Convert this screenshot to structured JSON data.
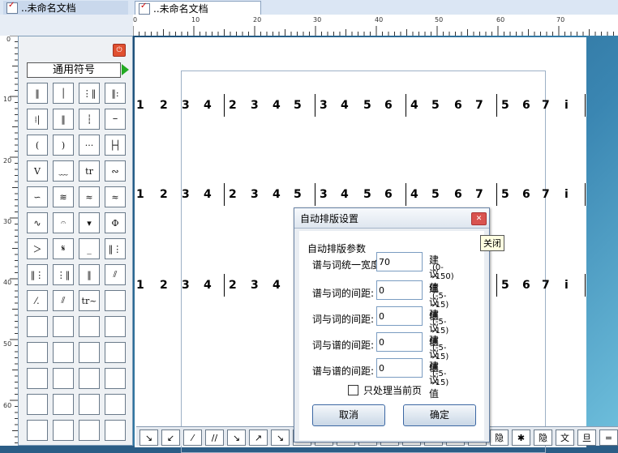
{
  "tabs": [
    "..未命名文档",
    "..未命名文档"
  ],
  "ruler": {
    "h_labels": [
      "0",
      "10",
      "20",
      "30",
      "40",
      "50",
      "60",
      "70"
    ],
    "v_labels": [
      "0",
      "10",
      "20",
      "30",
      "40",
      "50",
      "60"
    ]
  },
  "palette": {
    "title": "通用符号",
    "close_icon": "close-icon",
    "cells": [
      "‖",
      "│",
      "⋮‖",
      "‖:",
      "⁞|",
      "‖",
      "┆",
      "ⲻ",
      "(",
      ")",
      "···",
      "├┤",
      "V",
      "﹏",
      "tr",
      "∾",
      "∽",
      "≋",
      "≈",
      "≈",
      "∿",
      "𝄐",
      "▾",
      "Φ",
      "＞",
      "𝄋",
      "_",
      "‖⋮",
      "‖⋮",
      "⋮‖",
      "‖",
      "⫽",
      "⁄.",
      "⫽",
      "tr~",
      "",
      "",
      "",
      "",
      "",
      "",
      "",
      "",
      "",
      "",
      "",
      "",
      "",
      "",
      "",
      "",
      "",
      "",
      "",
      "",
      ""
    ]
  },
  "score": {
    "staffs": [
      {
        "notes": [
          "1",
          "2",
          "3",
          "4",
          "2",
          "3",
          "4",
          "5",
          "3",
          "4",
          "5",
          "6",
          "4",
          "5",
          "6",
          "7",
          "5",
          "6",
          "7",
          "i"
        ]
      },
      {
        "notes": [
          "1",
          "2",
          "3",
          "4",
          "2",
          "3",
          "4",
          "5",
          "3",
          "4",
          "5",
          "6",
          "4",
          "5",
          "6",
          "7",
          "5",
          "6",
          "7",
          "i"
        ]
      },
      {
        "notes": [
          "1",
          "2",
          "3",
          "4",
          "2",
          "3",
          "4",
          "5",
          "",
          "",
          "",
          "",
          "",
          "",
          "",
          "",
          "5",
          "6",
          "7",
          "i"
        ]
      }
    ]
  },
  "bottom_toolbar": [
    "↘",
    "↙",
    "⁄",
    "//",
    "↘",
    "↗",
    "↘",
    "·",
    "",
    "",
    "",
    "",
    "",
    "",
    "",
    "隐",
    "隐",
    "✱",
    "隐",
    "文",
    "旦",
    "="
  ],
  "dialog": {
    "title": "自动排版设置",
    "group_label": "自动排版参数",
    "fields": [
      {
        "label": "谱与词统一宽度:",
        "value": "70",
        "hint": "建议值",
        "range": "(0--150)"
      },
      {
        "label": "谱与词的间距:",
        "value": "0",
        "hint": "建议值",
        "range": "(-5--15)"
      },
      {
        "label": "词与词的间距:",
        "value": "0",
        "hint": "建议值",
        "range": "(-5--15)"
      },
      {
        "label": "词与谱的间距:",
        "value": "0",
        "hint": "建议值",
        "range": "(-5--15)"
      },
      {
        "label": "谱与谱的间距:",
        "value": "0",
        "hint": "建议值",
        "range": "(-5--15)"
      }
    ],
    "checkbox_label": "只处理当前页",
    "cancel": "取消",
    "ok": "确定",
    "tooltip": "关闭"
  }
}
